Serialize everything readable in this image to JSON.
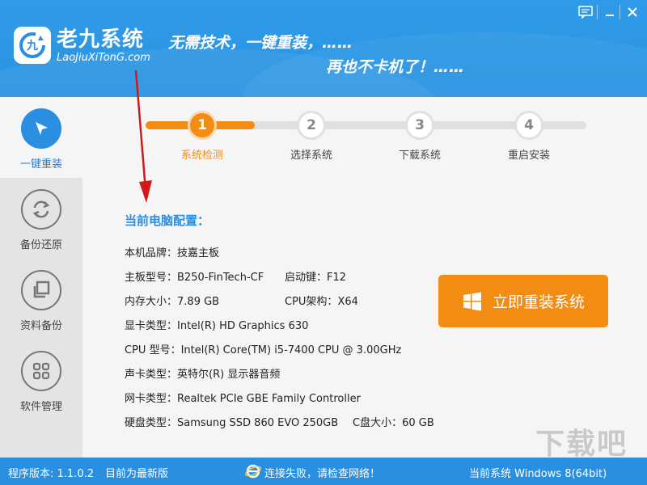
{
  "header": {
    "brand_name": "老九系统",
    "brand_url": "LaoJiuXiTonG.com",
    "slogan_line1": "无需技术，一键重装，……",
    "slogan_line2": "再也不卡机了！……"
  },
  "sidebar": {
    "items": [
      {
        "label": "一键重装",
        "icon": "cursor-icon",
        "active": true
      },
      {
        "label": "备份还原",
        "icon": "refresh-icon",
        "active": false
      },
      {
        "label": "资料备份",
        "icon": "copy-icon",
        "active": false
      },
      {
        "label": "软件管理",
        "icon": "grid-icon",
        "active": false
      }
    ]
  },
  "steps": [
    {
      "number": "1",
      "label": "系统检测"
    },
    {
      "number": "2",
      "label": "选择系统"
    },
    {
      "number": "3",
      "label": "下载系统"
    },
    {
      "number": "4",
      "label": "重启安装"
    }
  ],
  "config": {
    "title": "当前电脑配置：",
    "brand_label": "本机品牌：",
    "brand_value": "技嘉主板",
    "board_label": "主板型号：",
    "board_value": "B250-FinTech-CF",
    "bootkey_label": "启动键：",
    "bootkey_value": "F12",
    "memory_label": "内存大小：",
    "memory_value": "7.89 GB",
    "cpuarch_label": "CPU架构：",
    "cpuarch_value": "X64",
    "gpu_label": "显卡类型：",
    "gpu_value": "Intel(R) HD Graphics 630",
    "cpu_label": "CPU 型号：",
    "cpu_value": "Intel(R) Core(TM) i5-7400 CPU @ 3.00GHz",
    "sound_label": "声卡类型：",
    "sound_value": "英特尔(R) 显示器音频",
    "nic_label": "网卡类型：",
    "nic_value": "Realtek PCIe GBE Family Controller",
    "disk_label": "硬盘类型：",
    "disk_value": "Samsung SSD 860 EVO 250GB",
    "cdrive_label": "C盘大小：",
    "cdrive_value": "60 GB"
  },
  "reinstall_button": "立即重装系统",
  "footer": {
    "version": "程序版本: 1.1.0.2",
    "latest": "目前为最新版",
    "network": "连接失败，请检查网络！",
    "current_system": "当前系统 Windows 8(64bit)"
  },
  "watermark": "下载吧",
  "colors": {
    "primary_blue": "#2a8fe0",
    "accent_orange": "#f28c13",
    "arrow_red": "#d0191b"
  }
}
